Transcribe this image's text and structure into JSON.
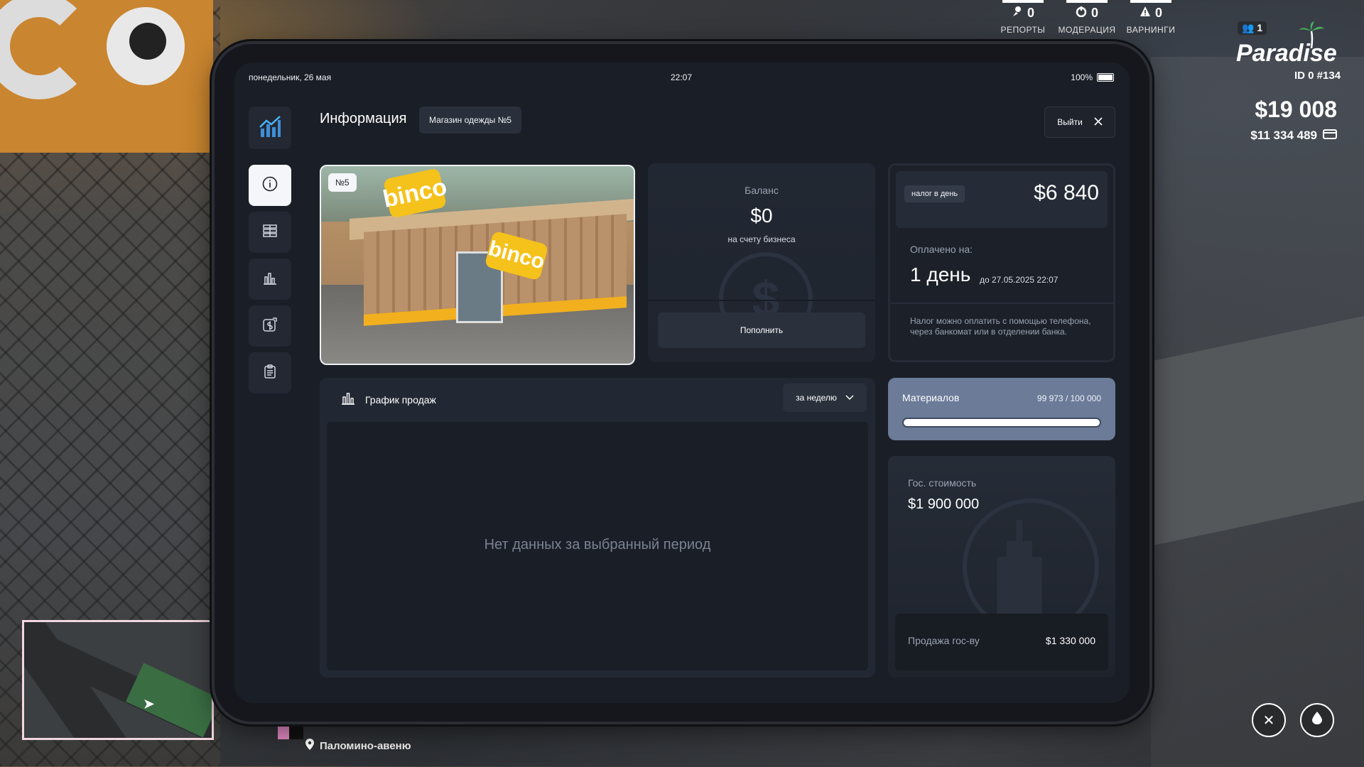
{
  "hud": {
    "stats": [
      {
        "icon": "report-icon",
        "value": "0",
        "label": "РЕПОРТЫ"
      },
      {
        "icon": "moderation-icon",
        "value": "0",
        "label": "МОДЕРАЦИЯ"
      },
      {
        "icon": "warning-icon",
        "value": "0",
        "label": "ВАРНИНГИ"
      }
    ],
    "online": "1",
    "logo": "Paradise",
    "player_id": "ID 0 #134",
    "cash": "$19 008",
    "bank": "$11 334 489",
    "street": "Паломино-авеню"
  },
  "statusbar": {
    "date": "понедельник, 26 мая",
    "time": "22:07",
    "battery": "100%"
  },
  "header": {
    "title": "Информация",
    "business": "Магазин одежды №5",
    "exit_label": "Выйти"
  },
  "sidebar": {
    "items": [
      {
        "icon": "info-icon",
        "active": true
      },
      {
        "icon": "list-icon",
        "active": false
      },
      {
        "icon": "chart-icon",
        "active": false
      },
      {
        "icon": "money-transfer-icon",
        "active": false
      },
      {
        "icon": "clipboard-icon",
        "active": false
      }
    ]
  },
  "photo": {
    "badge": "№5",
    "sign_text": "binco"
  },
  "balance": {
    "label": "Баланс",
    "value": "$0",
    "sub": "на счету бизнеса",
    "button": "Пополнить"
  },
  "tax": {
    "chip": "налог в день",
    "amount": "$6 840",
    "paid_label": "Оплачено на:",
    "paid_value": "1 день",
    "paid_until": "до 27.05.2025 22:07",
    "note": "Налог можно оплатить с помощью телефона, через банкомат или в отделении банка."
  },
  "materials": {
    "label": "Материалов",
    "value": "99 973 / 100 000",
    "current": 99973,
    "max": 100000
  },
  "gov": {
    "label": "Гос. стоимость",
    "value": "$1 900 000",
    "sell_label": "Продажа гос-ву",
    "sell_value": "$1 330 000"
  },
  "sales": {
    "title": "График продаж",
    "period": "за неделю",
    "empty": "Нет данных за выбранный период"
  }
}
